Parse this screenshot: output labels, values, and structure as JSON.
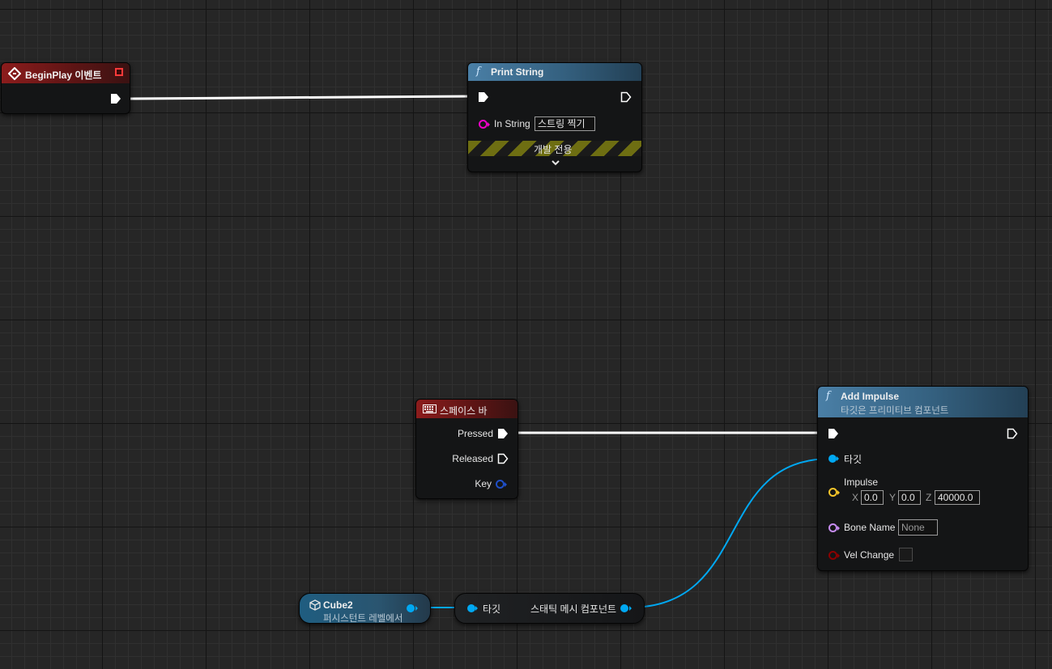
{
  "begin_play": {
    "title": "BeginPlay 이벤트"
  },
  "print_string": {
    "title": "Print String",
    "func_glyph": "f",
    "in_string_label": "In String",
    "in_string_value": "스트링 찍기",
    "dev_only_label": "개발 전용",
    "expand_glyph": "⌄"
  },
  "space_bar": {
    "title": "스페이스 바",
    "pressed_label": "Pressed",
    "released_label": "Released",
    "key_label": "Key"
  },
  "add_impulse": {
    "title": "Add Impulse",
    "subtitle": "타깃은 프리미티브 컴포넌트",
    "func_glyph": "f",
    "target_label": "타깃",
    "impulse_label": "Impulse",
    "x_label": "X",
    "x_value": "0.0",
    "y_label": "Y",
    "y_value": "0.0",
    "z_label": "Z",
    "z_value": "40000.0",
    "bone_name_label": "Bone Name",
    "bone_name_value": "None",
    "vel_change_label": "Vel Change",
    "vel_change_checked": false
  },
  "cube2": {
    "title": "Cube2",
    "subtitle": "퍼시스턴트 레벨에서"
  },
  "static_mesh": {
    "target_label": "타깃",
    "output_label": "스태틱 메시 컴포넌트"
  },
  "colors": {
    "exec": "#ffffff",
    "object_pin": "#00a8f2",
    "string_pin": "#f000c8",
    "vector_pin": "#f8c62a",
    "name_pin": "#c68cf0",
    "bool_pin": "#8c0000",
    "struct_pin": "#1f4fc8"
  }
}
